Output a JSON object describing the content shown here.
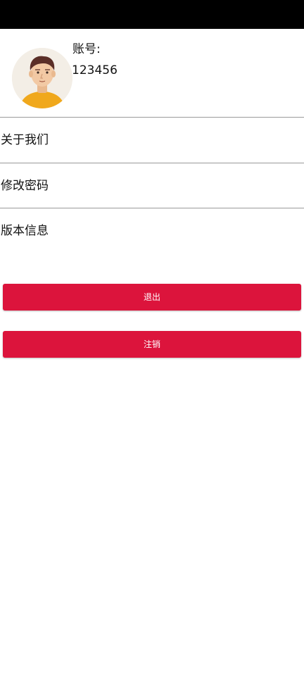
{
  "profile": {
    "account_label": "账号:",
    "account_value": "123456",
    "avatar_icon": "person-avatar-icon"
  },
  "menu": {
    "items": [
      {
        "label": "关于我们"
      },
      {
        "label": "修改密码"
      },
      {
        "label": "版本信息"
      }
    ]
  },
  "buttons": {
    "logout_label": "退出",
    "deregister_label": "注销",
    "color": "#dc143c"
  }
}
